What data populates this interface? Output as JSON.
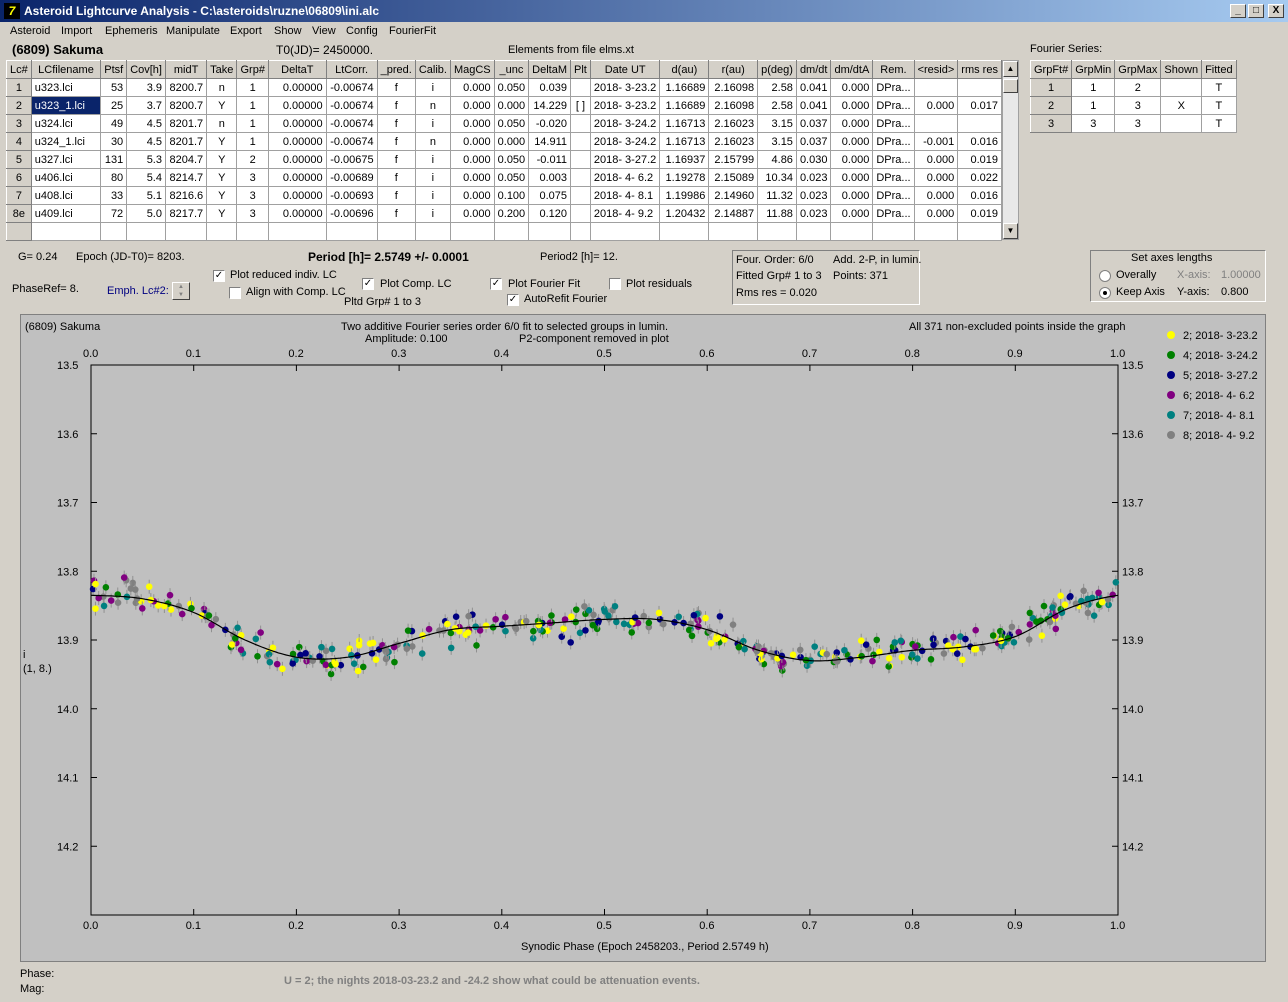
{
  "window": {
    "title": "Asteroid Lightcurve Analysis - C:\\asteroids\\ruzne\\06809\\ini.alc",
    "min": "_",
    "max": "□",
    "close": "X"
  },
  "menu": [
    "Asteroid",
    "Import",
    "Ephemeris",
    "Manipulate",
    "Export",
    "Show",
    "View",
    "Config",
    "FourierFit"
  ],
  "asteroid": "(6809) Sakuma",
  "t0": "T0(JD)= 2450000.",
  "elements": "Elements from file elms.xt",
  "lc_table": {
    "headers": [
      "Lc#",
      "LCfilename",
      "Ptsf",
      "Cov[h]",
      "midT",
      "Take",
      "Grp#",
      "DeltaT",
      "LtCorr.",
      "_pred.",
      "Calib.",
      "MagCS",
      "_unc",
      "DeltaM",
      "Plt",
      "Date UT",
      "d(au)",
      "r(au)",
      "p(deg)",
      "dm/dt",
      "dm/dtA",
      "Rem.",
      "<resid>",
      "rms res"
    ],
    "rows": [
      [
        "1",
        "u323.lci",
        "53",
        "3.9",
        "8200.7",
        "n",
        "1",
        "0.00000",
        "-0.00674",
        "f",
        "i",
        "0.000",
        "0.050",
        "0.039",
        "",
        "2018- 3-23.2",
        "1.16689",
        "2.16098",
        "2.58",
        "0.041",
        "0.000",
        "DPra...",
        "",
        ""
      ],
      [
        "2",
        "u323_1.lci",
        "25",
        "3.7",
        "8200.7",
        "Y",
        "1",
        "0.00000",
        "-0.00674",
        "f",
        "n",
        "0.000",
        "0.000",
        "14.229",
        "[ ]",
        "2018- 3-23.2",
        "1.16689",
        "2.16098",
        "2.58",
        "0.041",
        "0.000",
        "DPra...",
        "0.000",
        "0.017"
      ],
      [
        "3",
        "u324.lci",
        "49",
        "4.5",
        "8201.7",
        "n",
        "1",
        "0.00000",
        "-0.00674",
        "f",
        "i",
        "0.000",
        "0.050",
        "-0.020",
        "",
        "2018- 3-24.2",
        "1.16713",
        "2.16023",
        "3.15",
        "0.037",
        "0.000",
        "DPra...",
        "",
        ""
      ],
      [
        "4",
        "u324_1.lci",
        "30",
        "4.5",
        "8201.7",
        "Y",
        "1",
        "0.00000",
        "-0.00674",
        "f",
        "n",
        "0.000",
        "0.000",
        "14.911",
        "",
        "2018- 3-24.2",
        "1.16713",
        "2.16023",
        "3.15",
        "0.037",
        "0.000",
        "DPra...",
        "-0.001",
        "0.016"
      ],
      [
        "5",
        "u327.lci",
        "131",
        "5.3",
        "8204.7",
        "Y",
        "2",
        "0.00000",
        "-0.00675",
        "f",
        "i",
        "0.000",
        "0.050",
        "-0.011",
        "",
        "2018- 3-27.2",
        "1.16937",
        "2.15799",
        "4.86",
        "0.030",
        "0.000",
        "DPra...",
        "0.000",
        "0.019"
      ],
      [
        "6",
        "u406.lci",
        "80",
        "5.4",
        "8214.7",
        "Y",
        "3",
        "0.00000",
        "-0.00689",
        "f",
        "i",
        "0.000",
        "0.050",
        "0.003",
        "",
        "2018- 4- 6.2",
        "1.19278",
        "2.15089",
        "10.34",
        "0.023",
        "0.000",
        "DPra...",
        "0.000",
        "0.022"
      ],
      [
        "7",
        "u408.lci",
        "33",
        "5.1",
        "8216.6",
        "Y",
        "3",
        "0.00000",
        "-0.00693",
        "f",
        "i",
        "0.000",
        "0.100",
        "0.075",
        "",
        "2018- 4- 8.1",
        "1.19986",
        "2.14960",
        "11.32",
        "0.023",
        "0.000",
        "DPra...",
        "0.000",
        "0.016"
      ],
      [
        "8e",
        "u409.lci",
        "72",
        "5.0",
        "8217.7",
        "Y",
        "3",
        "0.00000",
        "-0.00696",
        "f",
        "i",
        "0.000",
        "0.200",
        "0.120",
        "",
        "2018- 4- 9.2",
        "1.20432",
        "2.14887",
        "11.88",
        "0.023",
        "0.000",
        "DPra...",
        "0.000",
        "0.019"
      ]
    ]
  },
  "fourier_table": {
    "title": "Fourier Series:",
    "headers": [
      "GrpFt#",
      "GrpMin",
      "GrpMax",
      "Shown",
      "Fitted"
    ],
    "rows": [
      [
        "1",
        "1",
        "2",
        "",
        "T"
      ],
      [
        "2",
        "1",
        "3",
        "X",
        "T"
      ],
      [
        "3",
        "3",
        "3",
        "",
        "T"
      ]
    ]
  },
  "controls": {
    "g": "G= 0.24",
    "epoch": "Epoch (JD-T0)= 8203.",
    "period": "Period [h]= 2.5749 +/- 0.0001",
    "period2": "Period2 [h]= 12.",
    "phaseref": "PhaseRef= 8.",
    "emph": "Emph. Lc#2:",
    "plot_reduced": "Plot reduced indiv. LC",
    "align": "Align with Comp. LC",
    "plot_comp": "Plot Comp. LC",
    "pltd_grp": "Pltd Grp#  1   to   3",
    "plot_fourier": "Plot Fourier Fit",
    "autorefit": "AutoRefit Fourier",
    "plot_resid": "Plot residuals"
  },
  "info_box": {
    "order": "Four. Order:  6/0",
    "add": "Add. 2-P, in lumin.",
    "fitted": "Fitted Grp# 1 to 3",
    "points": "Points: 371",
    "rms": "Rms res      = 0.020"
  },
  "axes_box": {
    "title": "Set axes lengths",
    "overally": "Overally",
    "keep": "Keep Axis",
    "xaxis_label": "X-axis:",
    "xaxis_val": "1.00000",
    "yaxis_label": "Y-axis:",
    "yaxis_val": "0.800"
  },
  "plot": {
    "name": "(6809) Sakuma",
    "line1": "Two additive Fourier series order 6/0 fit to selected groups in lumin.",
    "line2_a": "Amplitude: 0.100",
    "line2_b": "P2-component removed in plot",
    "right_note": "All 371 non-excluded points inside the graph",
    "xlabel": "Synodic Phase (Epoch 2458203., Period 2.5749 h)",
    "ylabel_1": "i",
    "ylabel_2": "(1, 8.)",
    "xticks": [
      "0.0",
      "0.1",
      "0.2",
      "0.3",
      "0.4",
      "0.5",
      "0.6",
      "0.7",
      "0.8",
      "0.9",
      "1.0"
    ],
    "yticks": [
      "13.5",
      "13.6",
      "13.7",
      "13.8",
      "13.9",
      "14.0",
      "14.1",
      "14.2"
    ],
    "legend": [
      {
        "label": "2; 2018- 3-23.2",
        "color": "#ffff00"
      },
      {
        "label": "4; 2018- 3-24.2",
        "color": "#008000"
      },
      {
        "label": "5; 2018- 3-27.2",
        "color": "#000080"
      },
      {
        "label": "6; 2018- 4- 6.2",
        "color": "#800080"
      },
      {
        "label": "7; 2018- 4- 8.1",
        "color": "#008080"
      },
      {
        "label": "8; 2018- 4- 9.2",
        "color": "#808080"
      }
    ]
  },
  "chart_data": {
    "type": "scatter",
    "title": "(6809) Sakuma",
    "xlabel": "Synodic Phase (Epoch 2458203., Period 2.5749 h)",
    "ylabel": "i (1, 8.)",
    "xlim": [
      0,
      1
    ],
    "ylim": [
      13.5,
      14.3
    ],
    "y_inverted": true,
    "grid": false,
    "legend_position": "top-right",
    "fit_curve": {
      "x": [
        0,
        0.05,
        0.1,
        0.15,
        0.2,
        0.25,
        0.3,
        0.35,
        0.4,
        0.45,
        0.5,
        0.55,
        0.6,
        0.65,
        0.7,
        0.75,
        0.8,
        0.85,
        0.9,
        0.95,
        1.0
      ],
      "y": [
        13.835,
        13.84,
        13.86,
        13.9,
        13.925,
        13.925,
        13.905,
        13.885,
        13.88,
        13.875,
        13.87,
        13.87,
        13.885,
        13.915,
        13.93,
        13.925,
        13.915,
        13.91,
        13.895,
        13.855,
        13.835
      ]
    },
    "series": [
      {
        "name": "2; 2018- 3-23.2"
      },
      {
        "name": "4; 2018- 3-24.2"
      },
      {
        "name": "5; 2018- 3-27.2"
      },
      {
        "name": "6; 2018- 4- 6.2"
      },
      {
        "name": "7; 2018- 4- 8.1"
      },
      {
        "name": "8; 2018- 4- 9.2"
      }
    ],
    "points_total": 371
  },
  "footer": {
    "phase": "Phase:",
    "mag": "Mag:",
    "note": "U = 2; the nights 2018-03-23.2 and -24.2 show what could be attenuation events."
  }
}
